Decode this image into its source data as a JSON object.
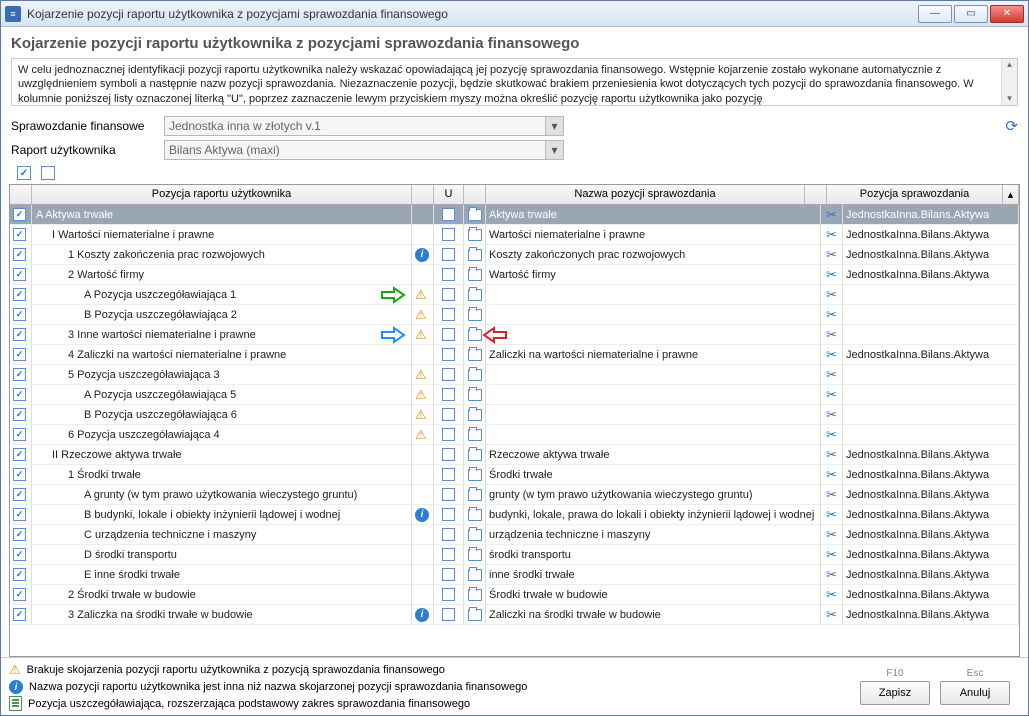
{
  "window": {
    "title": "Kojarzenie pozycji raportu użytkownika z pozycjami sprawozdania finansowego"
  },
  "header": {
    "title": "Kojarzenie pozycji raportu użytkownika z pozycjami sprawozdania finansowego",
    "description": "W celu jednoznacznej identyfikacji pozycji raportu użytkownika należy wskazać opowiadającą jej pozycję sprawozdania finansowego. Wstępnie kojarzenie zostało wykonane automatycznie z uwzględnieniem symboli a następnie nazw pozycji sprawozdania. Niezaznaczenie pozycji, będzie skutkować brakiem przeniesienia kwot dotyczących tych pozycji do sprawozdania finansowego. W kolumnie poniższej listy oznaczonej literką \"U\", poprzez zaznaczenie lewym przyciskiem myszy można określić pozycję raportu użytkownika jako pozycję"
  },
  "form": {
    "sprawozdanie_label": "Sprawozdanie finansowe",
    "sprawozdanie_value": "Jednostka inna w złotych v.1",
    "raport_label": "Raport użytkownika",
    "raport_value": "Bilans Aktywa (maxi)"
  },
  "columns": {
    "pozycja_raportu": "Pozycja raportu użytkownika",
    "u": "U",
    "nazwa_pozycji": "Nazwa pozycji sprawozdania",
    "pozycja_sprawozdania": "Pozycja sprawozdania"
  },
  "rows": [
    {
      "chk": true,
      "indent": 0,
      "label": "A  Aktywa trwałe",
      "icon": "",
      "u": false,
      "folder": true,
      "name": "Aktywa trwałe",
      "sci": true,
      "path": "JednostkaInna.Bilans.Aktywa",
      "selected": true
    },
    {
      "chk": true,
      "indent": 1,
      "label": "I  Wartości niematerialne i prawne",
      "icon": "",
      "u": false,
      "folder": true,
      "name": "Wartości niematerialne i prawne",
      "sci": true,
      "path": "JednostkaInna.Bilans.Aktywa"
    },
    {
      "chk": true,
      "indent": 2,
      "label": "1  Koszty zakończenia prac rozwojowych",
      "icon": "info",
      "u": false,
      "folder": true,
      "name": "Koszty zakończonych prac rozwojowych",
      "sci": true,
      "path": "JednostkaInna.Bilans.Aktywa"
    },
    {
      "chk": true,
      "indent": 2,
      "label": "2  Wartość firmy",
      "icon": "",
      "u": false,
      "folder": true,
      "name": "Wartość firmy",
      "sci": true,
      "path": "JednostkaInna.Bilans.Aktywa"
    },
    {
      "chk": true,
      "indent": 3,
      "label": "A  Pozycja uszczegóławiająca 1",
      "icon": "warn",
      "u": false,
      "folder": true,
      "name": "",
      "sci": true,
      "path": "",
      "arrow_left": "green"
    },
    {
      "chk": true,
      "indent": 3,
      "label": "B  Pozycja uszczegóławiająca 2",
      "icon": "warn",
      "u": false,
      "folder": true,
      "name": "",
      "sci": true,
      "path": ""
    },
    {
      "chk": true,
      "indent": 2,
      "label": "3  Inne wartości niematerialne i prawne",
      "icon": "warn",
      "u": false,
      "folder": true,
      "name": "",
      "sci": true,
      "path": "",
      "arrow_left": "blue",
      "arrow_right": "red"
    },
    {
      "chk": true,
      "indent": 2,
      "label": "4  Zaliczki na wartości niematerialne i prawne",
      "icon": "",
      "u": false,
      "folder": true,
      "name": "Zaliczki na wartości niematerialne i prawne",
      "sci": true,
      "path": "JednostkaInna.Bilans.Aktywa"
    },
    {
      "chk": true,
      "indent": 2,
      "label": "5  Pozycja uszczegóławiająca 3",
      "icon": "warn",
      "u": false,
      "folder": true,
      "name": "",
      "sci": true,
      "path": ""
    },
    {
      "chk": true,
      "indent": 3,
      "label": "A  Pozycja uszczegóławiająca 5",
      "icon": "warn",
      "u": false,
      "folder": true,
      "name": "",
      "sci": true,
      "path": ""
    },
    {
      "chk": true,
      "indent": 3,
      "label": "B  Pozycja uszczegóławiająca 6",
      "icon": "warn",
      "u": false,
      "folder": true,
      "name": "",
      "sci": true,
      "path": ""
    },
    {
      "chk": true,
      "indent": 2,
      "label": "6  Pozycja uszczegóławiająca 4",
      "icon": "warn",
      "u": false,
      "folder": true,
      "name": "",
      "sci": true,
      "path": ""
    },
    {
      "chk": true,
      "indent": 1,
      "label": "II  Rzeczowe aktywa trwałe",
      "icon": "",
      "u": false,
      "folder": true,
      "name": "Rzeczowe aktywa trwałe",
      "sci": true,
      "path": "JednostkaInna.Bilans.Aktywa"
    },
    {
      "chk": true,
      "indent": 2,
      "label": "1  Środki trwałe",
      "icon": "",
      "u": false,
      "folder": true,
      "name": "Środki trwałe",
      "sci": true,
      "path": "JednostkaInna.Bilans.Aktywa"
    },
    {
      "chk": true,
      "indent": 3,
      "label": "A  grunty (w tym prawo użytkowania wieczystego gruntu)",
      "icon": "",
      "u": false,
      "folder": true,
      "name": "grunty (w tym prawo użytkowania wieczystego gruntu)",
      "sci": true,
      "path": "JednostkaInna.Bilans.Aktywa"
    },
    {
      "chk": true,
      "indent": 3,
      "label": "B  budynki, lokale i obiekty inżynierii lądowej i wodnej",
      "icon": "info",
      "u": false,
      "folder": true,
      "name": "budynki, lokale, prawa do lokali i obiekty inżynierii lądowej i wodnej",
      "sci": true,
      "path": "JednostkaInna.Bilans.Aktywa"
    },
    {
      "chk": true,
      "indent": 3,
      "label": "C  urządzenia techniczne i maszyny",
      "icon": "",
      "u": false,
      "folder": true,
      "name": "urządzenia techniczne i maszyny",
      "sci": true,
      "path": "JednostkaInna.Bilans.Aktywa"
    },
    {
      "chk": true,
      "indent": 3,
      "label": "D  środki transportu",
      "icon": "",
      "u": false,
      "folder": true,
      "name": "środki transportu",
      "sci": true,
      "path": "JednostkaInna.Bilans.Aktywa"
    },
    {
      "chk": true,
      "indent": 3,
      "label": "E  inne środki trwałe",
      "icon": "",
      "u": false,
      "folder": true,
      "name": "inne środki trwałe",
      "sci": true,
      "path": "JednostkaInna.Bilans.Aktywa"
    },
    {
      "chk": true,
      "indent": 2,
      "label": "2  Środki trwałe w budowie",
      "icon": "",
      "u": false,
      "folder": true,
      "name": "Środki trwałe w budowie",
      "sci": true,
      "path": "JednostkaInna.Bilans.Aktywa"
    },
    {
      "chk": true,
      "indent": 2,
      "label": "3  Zaliczka na środki trwałe w budowie",
      "icon": "info",
      "u": false,
      "folder": true,
      "name": "Zaliczki na środki trwałe w budowie",
      "sci": true,
      "path": "JednostkaInna.Bilans.Aktywa"
    }
  ],
  "legend": {
    "warn": "Brakuje skojarzenia pozycji raportu użytkownika z pozycją sprawozdania finansowego",
    "info": "Nazwa pozycji raportu użytkownika jest inna niż nazwa skojarzonej pozycji sprawozdania finansowego",
    "doc": "Pozycja uszczegóławiająca, rozszerzająca podstawowy zakres sprawozdania finansowego"
  },
  "footer": {
    "f10": "F10",
    "save": "Zapisz",
    "esc": "Esc",
    "cancel": "Anuluj"
  }
}
